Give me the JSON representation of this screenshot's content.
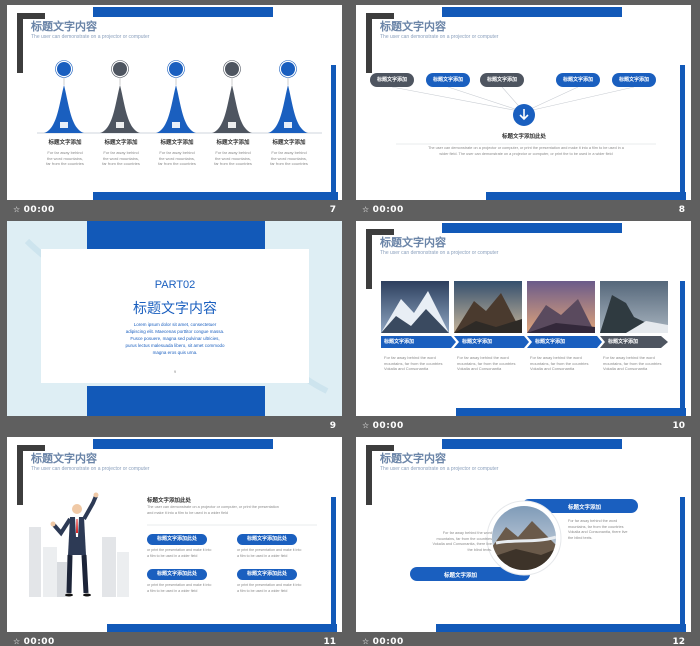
{
  "common": {
    "title": "标题文字内容",
    "subtitle": "The user can demonstrate on a projector or computer",
    "time": "00:00"
  },
  "s7": {
    "num": "7",
    "items": [
      {
        "label": "标题文字添加",
        "text": [
          "For far away behind",
          "the word mountains,",
          "far from the countries"
        ],
        "color": "#1a5fbf"
      },
      {
        "label": "标题文字添加",
        "text": [
          "For far away behind",
          "the word mountains,",
          "far from the countries"
        ],
        "color": "#4e5560"
      },
      {
        "label": "标题文字添加",
        "text": [
          "For far away behind",
          "the word mountains,",
          "far from the countries"
        ],
        "color": "#1a5fbf"
      },
      {
        "label": "标题文字添加",
        "text": [
          "For far away behind",
          "the word mountains,",
          "far from the countries"
        ],
        "color": "#4e5560"
      },
      {
        "label": "标题文字添加",
        "text": [
          "For far away behind",
          "the word mountains,",
          "far from the countries"
        ],
        "color": "#1a5fbf"
      }
    ]
  },
  "s8": {
    "num": "8",
    "pills": [
      "标题文字添加",
      "标题文字添加",
      "标题文字添加",
      "标题文字添加",
      "标题文字添加"
    ],
    "center_label": "标题文字添加此处",
    "body": [
      "The user can demonstrate on a projector or computer, or print the presentation and make it into a film to be used in a",
      "wider field. The user can demonstrate on a projector or computer, or print the to be used in a wider field"
    ]
  },
  "s9": {
    "num": "9",
    "part": "PART02",
    "title": "标题文字内容",
    "body": [
      "Lorem ipsum dolor sit amet, consectetuer",
      "adipiscing elit. Maecenas porttitor congue massa.",
      "Fusce posuere, magna sed pulvinar ultricies,",
      "purus lectus malesuada libero, sit amet commodo",
      "magna eros quis urna."
    ],
    "dot": "9"
  },
  "s10": {
    "num": "10",
    "items": [
      {
        "label": "标题文字添加",
        "text": [
          "For far away behind the word",
          "mountains, far from the countries",
          "Vokalia and Consonantia"
        ]
      },
      {
        "label": "标题文字添加",
        "text": [
          "For far away behind the word",
          "mountains, far from the countries",
          "Vokalia and Consonantia"
        ]
      },
      {
        "label": "标题文字添加",
        "text": [
          "For far away behind the word",
          "mountains, far from the countries",
          "Vokalia and Consonantia"
        ]
      },
      {
        "label": "标题文字添加",
        "text": [
          "For far away behind the word",
          "mountains, far from the countries",
          "Vokalia and Consonantia"
        ]
      }
    ]
  },
  "s11": {
    "num": "11",
    "heading": "标题文字添加此处",
    "body": [
      "The user can demonstrate on a projector or computer, or print the presentation",
      "and make it into a film to be used in a wider field"
    ],
    "pills": [
      {
        "label": "标题文字添加此处",
        "text": [
          "or print the presentation and make it into",
          "a film to be used in a wider field"
        ]
      },
      {
        "label": "标题文字添加此处",
        "text": [
          "or print the presentation and make it into",
          "a film to be used in a wider field"
        ]
      },
      {
        "label": "标题文字添加此处",
        "text": [
          "or print the presentation and make it into",
          "a film to be used in a wider field"
        ]
      },
      {
        "label": "标题文字添加此处",
        "text": [
          "or print the presentation and make it into",
          "a film to be used in a wider field"
        ]
      }
    ]
  },
  "s12": {
    "num": "12",
    "pill_top": "标题文字添加",
    "pill_bottom": "标题文字添加",
    "text_right": [
      "For far away behind the word",
      "mountains, far from the countries",
      "Vokalia and Consonantia, there live",
      "the blind texts."
    ],
    "text_left": [
      "For far away behind the word",
      "mountains, far from the countries",
      "Vokalia and Consonantia, there live",
      "the blind texts."
    ]
  }
}
